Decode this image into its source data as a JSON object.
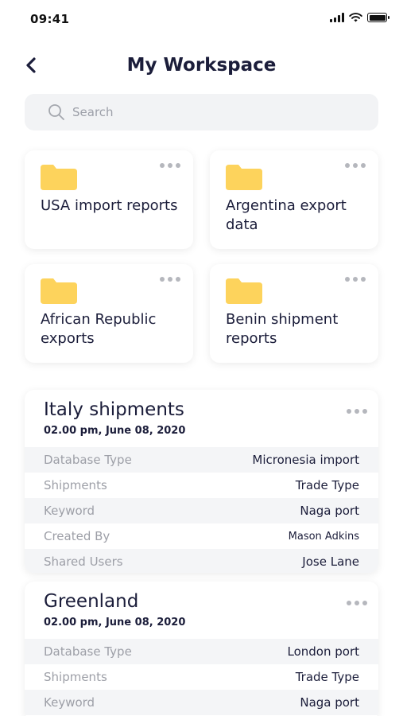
{
  "status_bar": {
    "time": "09:41"
  },
  "header": {
    "title": "My Workspace"
  },
  "search": {
    "placeholder": "Search"
  },
  "folders": [
    {
      "name": "USA import reports"
    },
    {
      "name": "Argentina export data"
    },
    {
      "name": "African Republic exports"
    },
    {
      "name": "Benin shipment reports"
    }
  ],
  "shipments": [
    {
      "title": "Italy shipments",
      "date": "02.00 pm, June 08, 2020",
      "rows": [
        {
          "label": "Database Type",
          "value": "Micronesia import"
        },
        {
          "label": "Shipments",
          "value": "Trade Type"
        },
        {
          "label": "Keyword",
          "value": "Naga port"
        },
        {
          "label": "Created By",
          "value": "Mason Adkins"
        },
        {
          "label": "Shared Users",
          "value": "Jose Lane"
        }
      ]
    },
    {
      "title": "Greenland",
      "date": "02.00 pm, June 08, 2020",
      "rows": [
        {
          "label": "Database Type",
          "value": "London port"
        },
        {
          "label": "Shipments",
          "value": "Trade Type"
        },
        {
          "label": "Keyword",
          "value": "Naga port"
        }
      ]
    }
  ],
  "colors": {
    "folder": "#fdd35c",
    "title_text": "#1b1d3a",
    "label_text": "#9d9fa7",
    "row_stripe": "#f4f5f7"
  },
  "icons": {
    "back": "chevron-left-icon",
    "search": "search-icon",
    "folder": "folder-icon",
    "more": "more-horizontal-icon"
  }
}
